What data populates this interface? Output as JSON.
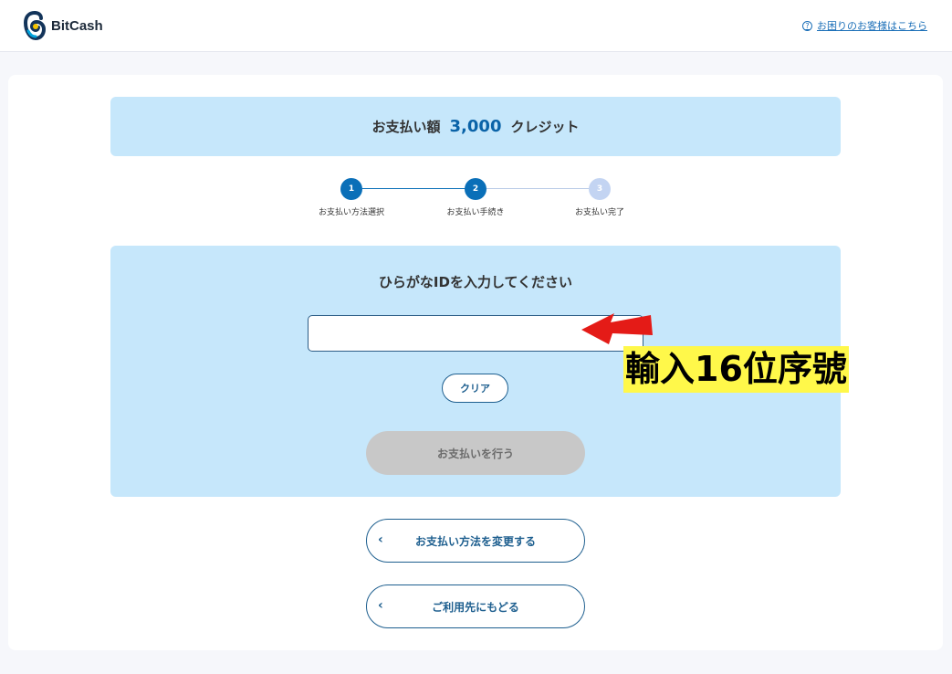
{
  "header": {
    "brand": "BitCash",
    "help_icon": "?",
    "help_link": "お困りのお客様はこちら"
  },
  "payment": {
    "label": "お支払い額",
    "amount": "3,000",
    "unit": "クレジット"
  },
  "steps": [
    {
      "number": "1",
      "label": "お支払い方法選択",
      "state": "done"
    },
    {
      "number": "2",
      "label": "お支払い手続き",
      "state": "current"
    },
    {
      "number": "3",
      "label": "お支払い完了",
      "state": "pending"
    }
  ],
  "form": {
    "title": "ひらがなIDを入力してください",
    "input_value": "",
    "clear_label": "クリア",
    "submit_label": "お支払いを行う"
  },
  "nav": {
    "change_method_label": "お支払い方法を変更する",
    "back_label": "ご利用先にもどる",
    "chevron": "‹"
  },
  "annotation": {
    "text": "輸入16位序號",
    "arrow_color": "#e41b17",
    "highlight_color": "#fff84a"
  },
  "colors": {
    "accent": "#0a6fb8",
    "panel": "#c6e7fb",
    "step_pending": "#c3d4f2"
  }
}
